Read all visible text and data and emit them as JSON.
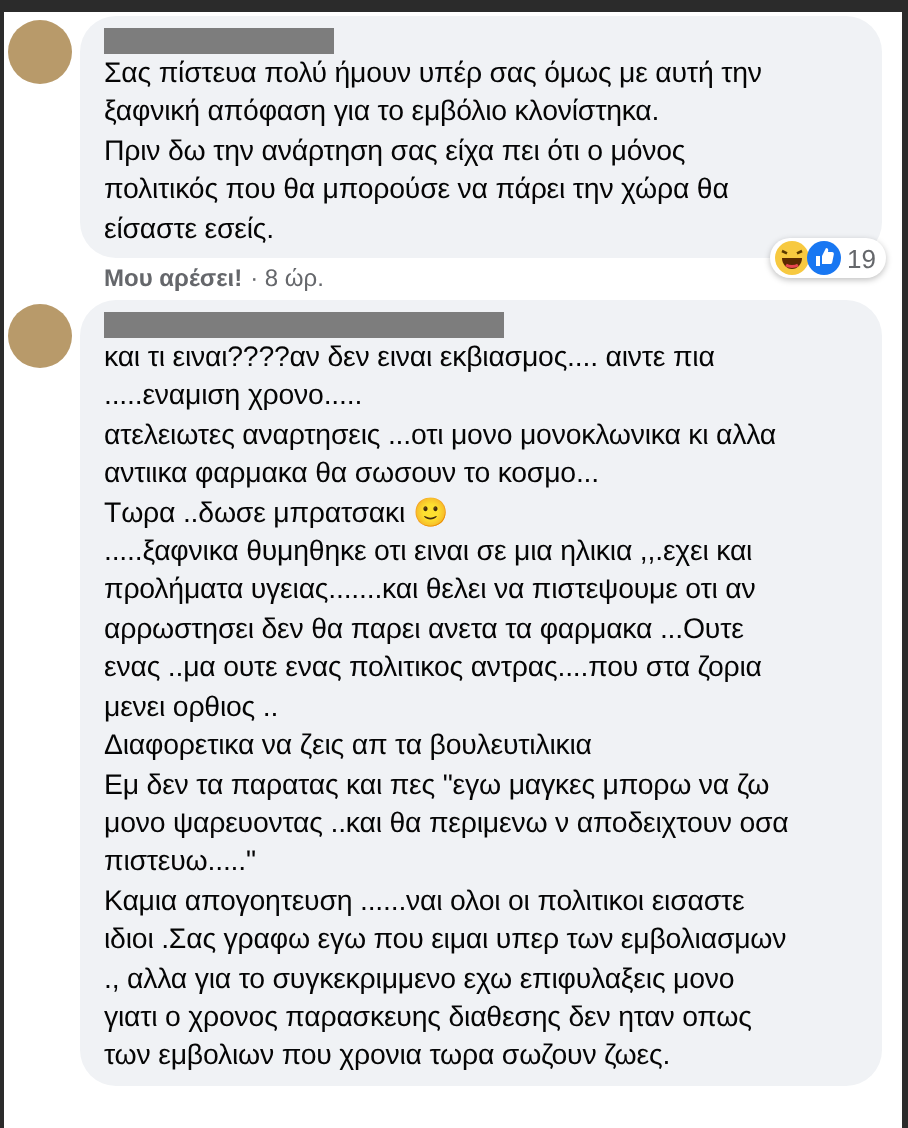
{
  "comments": [
    {
      "text": "Σας πίστευα πολύ ήμουν υπέρ σας όμως με αυτή την\nξαφνική απόφαση για το εμβόλιο κλονίστηκα.\nΠριν δω την ανάρτηση σας είχα πει ότι ο μόνος\nπολιτικός που θα μπορούσε να πάρει την χώρα θα\nείσαστε εσείς.",
      "reactions": {
        "count": "19"
      },
      "like_label": "Μου αρέσει!",
      "time": "· 8 ώρ."
    },
    {
      "text": "και τι ειναι????αν δεν ειναι εκβιασμος.... αιντε πια\n.....εναμιση χρονο.....\nατελειωτες αναρτησεις ...οτι μονο μονοκλωνικα κι αλλα\nαντιικα φαρμακα θα σωσουν το κοσμο...\nΤωρα ..δωσε μπρατσακι 🙂\n.....ξαφνικα θυμηθηκε οτι ειναι σε μια ηλικια ,,.εχει και\nπρολήματα υγειας.......και θελει να πιστεψουμε οτι αν\nαρρωστησει δεν θα παρει ανετα τα φαρμακα ...Ουτε\nενας ..μα ουτε ενας πολιτικος αντρας....που στα ζορια\nμενει ορθιος ..\nΔιαφορετικα να ζεις απ τα βουλευτιλικια\nΕμ δεν τα παρατας και πες \"εγω μαγκες μπορω να ζω\nμονο ψαρευοντας ..και θα περιμενω ν αποδειχτουν οσα\nπιστευω.....\"\nΚαμια απογοητευση ......ναι ολοι οι πολιτικοι εισαστε\nιδιοι .Σας γραφω εγω που ειμαι υπερ των εμβολιασμων\n., αλλα για το συγκεκριμμενο εχω επιφυλαξεις μονο\nγιατι ο χρονος παρασκευης διαθεσης δεν ηταν οπως\nτων εμβολιων που χρονια τωρα σωζουν ζωες."
    }
  ]
}
